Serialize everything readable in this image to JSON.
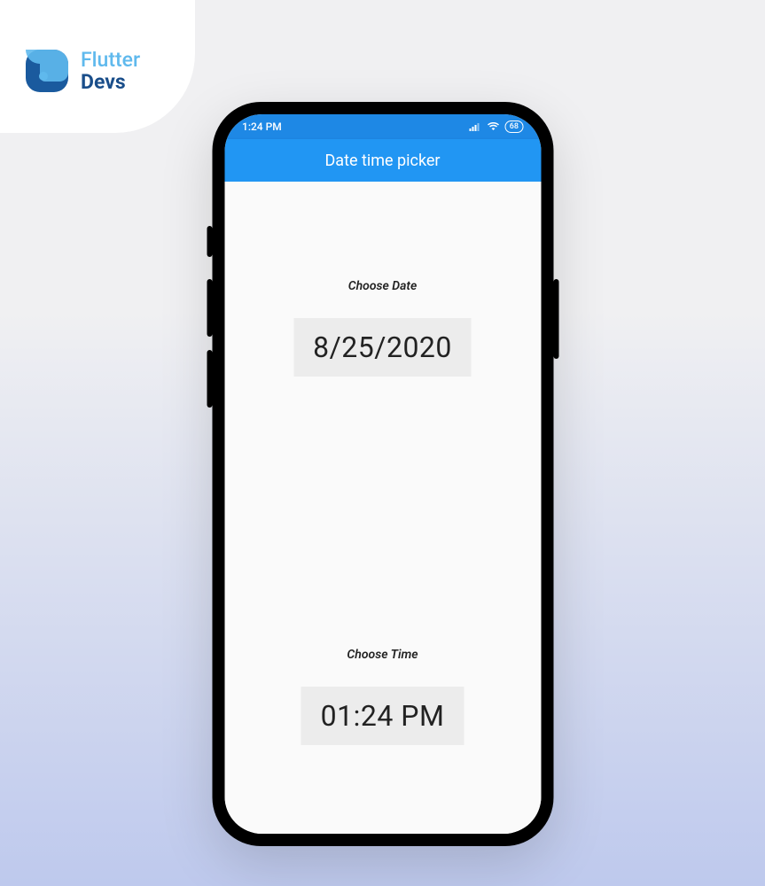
{
  "logo": {
    "line1": "Flutter",
    "line2": "Devs"
  },
  "status_bar": {
    "time": "1:24 PM",
    "battery": "68"
  },
  "app_bar": {
    "title": "Date time picker"
  },
  "date_section": {
    "label": "Choose Date",
    "value": "8/25/2020"
  },
  "time_section": {
    "label": "Choose Time",
    "value": "01:24 PM"
  },
  "colors": {
    "status_bar_bg": "#1e88e5",
    "app_bar_bg": "#2196f3",
    "button_bg": "#ececec"
  }
}
